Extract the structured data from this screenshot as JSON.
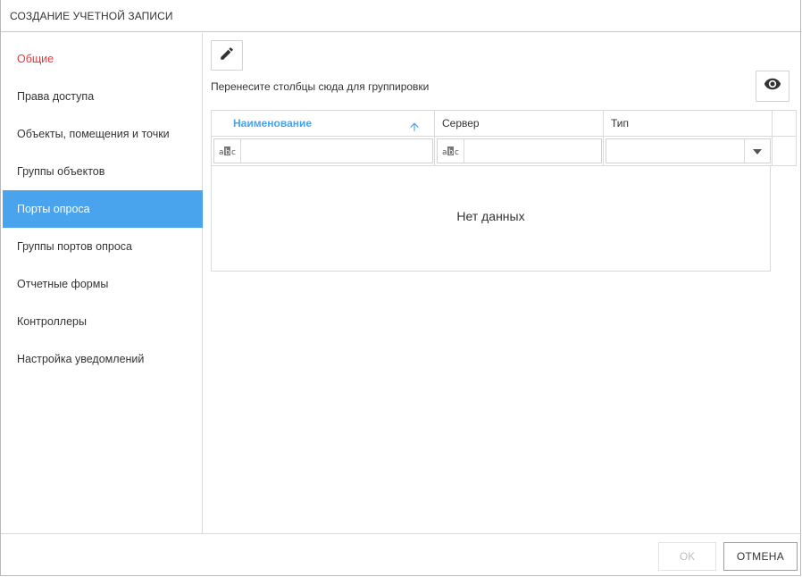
{
  "dialog": {
    "title": "СОЗДАНИЕ УЧЕТНОЙ ЗАПИСИ"
  },
  "sidebar": {
    "items": [
      {
        "label": "Общие",
        "state": "error"
      },
      {
        "label": "Права доступа",
        "state": "normal"
      },
      {
        "label": "Объекты, помещения и точки",
        "state": "normal"
      },
      {
        "label": "Группы объектов",
        "state": "normal"
      },
      {
        "label": "Порты опроса",
        "state": "active"
      },
      {
        "label": "Группы портов опроса",
        "state": "normal"
      },
      {
        "label": "Отчетные формы",
        "state": "normal"
      },
      {
        "label": "Контроллеры",
        "state": "normal"
      },
      {
        "label": "Настройка уведомлений",
        "state": "normal"
      }
    ]
  },
  "toolbar": {
    "edit_icon": "pencil-icon",
    "column_chooser_icon": "eye-icon"
  },
  "grid": {
    "group_panel_text": "Перенесите столбцы сюда для группировки",
    "columns": [
      {
        "label": "Наименование",
        "sorted": "asc",
        "filter": "text"
      },
      {
        "label": "Сервер",
        "filter": "text"
      },
      {
        "label": "Тип",
        "filter": "select"
      }
    ],
    "no_data_text": "Нет данных"
  },
  "footer": {
    "ok_label": "OK",
    "cancel_label": "ОТМЕНА"
  },
  "colors": {
    "accent": "#4aa3ed",
    "error": "#e53935"
  }
}
